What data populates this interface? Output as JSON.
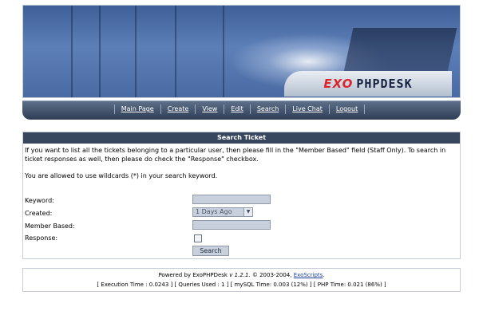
{
  "banner": {
    "logo_exo": "EXO",
    "logo_phpdesk": "PHPDESK"
  },
  "nav": {
    "items": [
      {
        "label": "Main Page"
      },
      {
        "label": "Create"
      },
      {
        "label": "View"
      },
      {
        "label": "Edit"
      },
      {
        "label": "Search"
      },
      {
        "label": "Live Chat"
      },
      {
        "label": "Logout"
      }
    ]
  },
  "search_panel": {
    "title": "Search Ticket",
    "description": "If you want to list all the tickets belonging to a particular user, then please fill in the \"Member Based\" field (Staff Only). To search in ticket responses as well, then please do check the \"Response\" checkbox.",
    "wildcard_note": "You are allowed to use wildcards (*) in your search keyword.",
    "fields": {
      "keyword_label": "Keyword:",
      "keyword_value": "",
      "created_label": "Created:",
      "created_value": "1 Days Ago",
      "member_label": "Member Based:",
      "member_value": "",
      "response_label": "Response:",
      "response_checked": false
    },
    "search_button": "Search"
  },
  "footer": {
    "powered_prefix": "Powered by ExoPHPDesk",
    "version": "v 1.2.1.",
    "copyright": "© 2003-2004,",
    "company_link": "ExoScripts",
    "period": ".",
    "stats": "[ Execution Time : 0.0243 ] [ Queries Used : 1 ] [ mySQL Time: 0.003 (12%) ] [ PHP Time: 0.021 (86%) ]"
  }
}
